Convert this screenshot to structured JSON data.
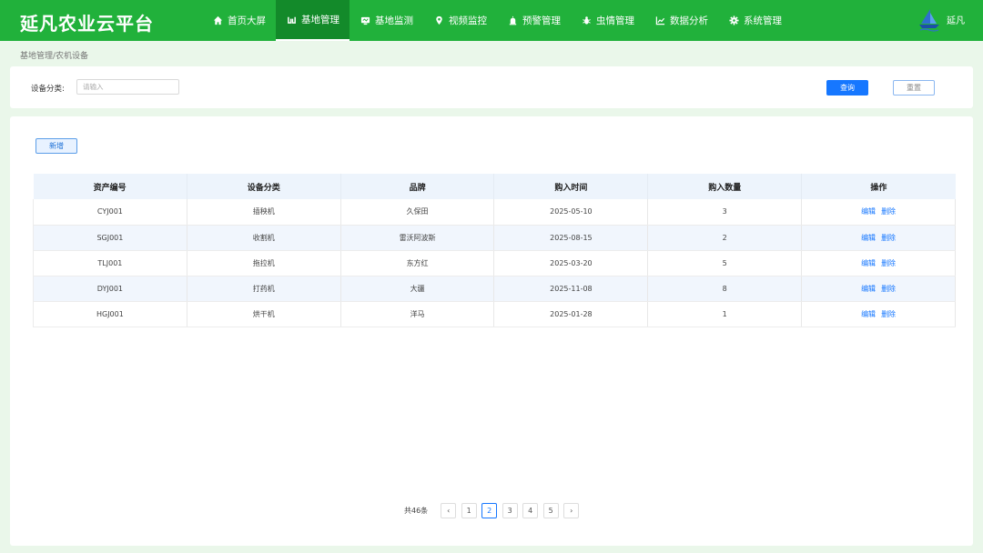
{
  "header": {
    "title": "延凡农业云平台",
    "nav": [
      {
        "label": "首页大屏",
        "icon": "home-icon"
      },
      {
        "label": "基地管理",
        "icon": "base-icon",
        "active": true
      },
      {
        "label": "基地监测",
        "icon": "monitor-icon"
      },
      {
        "label": "视频监控",
        "icon": "location-pin-icon"
      },
      {
        "label": "预警管理",
        "icon": "alarm-icon"
      },
      {
        "label": "虫情管理",
        "icon": "bug-icon"
      },
      {
        "label": "数据分析",
        "icon": "chart-icon"
      },
      {
        "label": "系统管理",
        "icon": "gear-icon"
      }
    ],
    "user": {
      "name": "延凡",
      "logo": "company-logo"
    }
  },
  "breadcrumb": "基地管理/农机设备",
  "search": {
    "label": "设备分类:",
    "placeholder": "请输入",
    "query_label": "查询",
    "reset_label": "重置"
  },
  "toolbar": {
    "add_label": "新增"
  },
  "table": {
    "columns": [
      "资产编号",
      "设备分类",
      "品牌",
      "购入时间",
      "购入数量",
      "操作"
    ],
    "rows": [
      {
        "id": "CYJ001",
        "category": "插秧机",
        "brand": "久保田",
        "date": "2025-05-10",
        "qty": "3"
      },
      {
        "id": "SGJ001",
        "category": "收割机",
        "brand": "雷沃阿波斯",
        "date": "2025-08-15",
        "qty": "2"
      },
      {
        "id": "TLJ001",
        "category": "拖拉机",
        "brand": "东方红",
        "date": "2025-03-20",
        "qty": "5"
      },
      {
        "id": "DYJ001",
        "category": "打药机",
        "brand": "大疆",
        "date": "2025-11-08",
        "qty": "8"
      },
      {
        "id": "HGJ001",
        "category": "烘干机",
        "brand": "洋马",
        "date": "2025-01-28",
        "qty": "1"
      }
    ],
    "edit_label": "编辑",
    "delete_label": "删除"
  },
  "pagination": {
    "total": "共46条",
    "pages": [
      "1",
      "2",
      "3",
      "4",
      "5"
    ],
    "current": "2"
  },
  "colors": {
    "header": "#21b13b",
    "active_nav": "#138a2a",
    "primary": "#1677ff"
  }
}
